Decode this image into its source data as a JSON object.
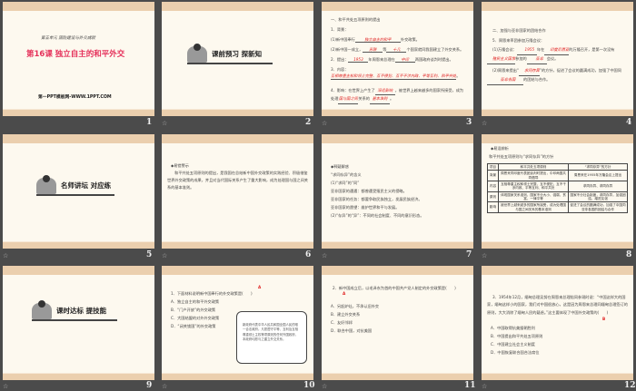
{
  "slides": [
    {
      "number": "1",
      "unit": "第五单元 国防建设与外交成就",
      "title": "第16课 独立自主的和平外交",
      "site": "第一PPT模板网-WWW.1PPT.COM"
    },
    {
      "number": "2",
      "section": "课前预习 探新知"
    },
    {
      "number": "3",
      "heading": "一、和平共处五项原则的提出",
      "l1": "1．背景：",
      "l2a": "(1)新中国奉行",
      "l2b": "独立自主的和平",
      "l2c": "外交政策。",
      "l3a": "(2)新中国一成立，",
      "l3b": "苏联",
      "l3c": "等",
      "l3d": "十几",
      "l3e": "个国家就同我国建立了外交关系。",
      "l4a": "2．提出：",
      "l4b": "1953",
      "l4c": "年周恩来总理在",
      "l4d": "中印",
      "l4e": "两国政府谈判时提出。",
      "l5a": "3．内容：",
      "l5b": "互相尊重主权和领土完整、互不侵犯、互不干涉内政、平等互利、和平共处",
      "l5c": "。",
      "l6a": "4．影响：在世界上产生了",
      "l6b": "深远影响",
      "l6c": "，被世界上越来越多的国家所接受，成为处理",
      "l6d": "国与国之间",
      "l6e": "关系的",
      "l6f": "基本准则",
      "l6g": "。"
    },
    {
      "number": "4",
      "heading": "二、加强与亚非国家的团结合作",
      "l1": "5．周恩来率团参加万隆会议：",
      "l2a": "(1)万隆会议：",
      "l2b": "1955",
      "l2c": "年在",
      "l2d": "印度尼西亚",
      "l2e": "的万隆召开，是第一次没有",
      "l2f": "殖民主义国家",
      "l2g": "参加的",
      "l2h": "亚非",
      "l2i": "会议。",
      "l3a": "(2)周恩来提出“",
      "l3b": "求同存异",
      "l3c": "”的方针，促进了会议的圆满成功，加强了中国同",
      "l3d": "亚非各国",
      "l3e": "的团结与合作。"
    },
    {
      "number": "5",
      "section": "名师讲坛 对应练"
    },
    {
      "number": "6",
      "heading": "◆易错警示",
      "body": "和平共处五项原则的提出，是我国在总结新中国外交政策的实践经验、积极借鉴世界外交政策的成果，并且对当代国际关系产生了重大影响，成为处理国与国之间关系的基本准则。"
    },
    {
      "number": "7",
      "heading": "◆释疑解惑",
      "sub": "“求同存异”的含义",
      "l1": "(1)“求同”的“同”",
      "l2": "亚非国家的遭遇：都曾遭受殖民主义的侵略。",
      "l3": "亚非国家的任务：都要争取民族独立，发展民族经济。",
      "l4": "亚非国家的愿望：维护世界和平与发展。",
      "l5": "(2)“存异”的“异”：不同的社会制度、不同的意识形态。"
    },
    {
      "number": "8",
      "heading": "◆易混辨析",
      "sub": "和平共处五项原则与“求同存异”的方针",
      "table": {
        "headers": [
          "项目",
          "和平共处五项原则",
          "“求同存异”的方针"
        ],
        "rows": [
          [
            "背景",
            "周恩来同印度代表团谈判时提出，中印两国共同倡导",
            "周恩来在1955年万隆会议上提出"
          ],
          [
            "内容",
            "互相尊重主权和领土完整、互不侵犯、互不干涉内政、平等互利、和平共处",
            "求同存异、求同存异"
          ],
          [
            "原则",
            "体现国家关系准则，国家不分大小、强弱、贫富，一律平等",
            "国家不分社会制度，求同存异，加强团结，增进友谊"
          ],
          [
            "影响",
            "被世界上越来越多的国家所接受，成为处理国与国之间关系的基本准则",
            "促进了会议的圆满成功，加强了中国同亚非各国的团结与合作"
          ]
        ]
      }
    },
    {
      "number": "9",
      "section": "课时达标 提技能"
    },
    {
      "number": "10",
      "answer": "A",
      "q": "1．下面材料说明新中国奉行的外交政策是(　　)",
      "options": [
        "A．独立自主的和平外交政策",
        "B．“门户开放”的外交政策",
        "C．大国结盟的对外外交政策",
        "D．“闭关锁国”的外交政策"
      ],
      "scroll": "新政府代表中华人民共和国全国人民的唯一合法政府。凡愿遵守平等、互利及互相尊重领土主权等项原则的任何外国政府，本政府均愿与之建立外交关系。"
    },
    {
      "number": "11",
      "answer": "A",
      "q": "2．新中国成立后，以毛泽东为首的中国共产党人制定的外交政策是(　　)",
      "options": [
        "A．另起炉灶，不承认旧外交",
        "B．建立外交关系",
        "C．友好邻邦",
        "D．联合中国，对抗美国"
      ]
    },
    {
      "number": "12",
      "answer": "B",
      "q": "3．1954年12月，缅甸总理吴努在周恩来总理陪同参观时说：“中国这样大的国家，缅甸这样小的国家，我们对中国很放心，这是因为周恩来总理同缅甸总理签订的原则，大大消除了缅甸人民的疑虑。”这主要体现了中国外交政策的(　　)",
      "options": [
        "A．中国取得抗美援朝胜利",
        "B．中国提出和平共处五项原则",
        "C．中国建立社会主义制度",
        "D．中国恢复联合国合法席位"
      ]
    }
  ]
}
